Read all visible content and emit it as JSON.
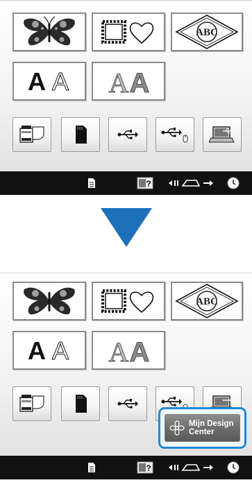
{
  "panels": {
    "top": {
      "categories": [
        {
          "name": "embroidery-patterns",
          "icon": "butterfly-icon"
        },
        {
          "name": "frame-patterns",
          "icon": "stamp-frame-and-heart-icon"
        },
        {
          "name": "monogram",
          "icon": "monogram-diamond-icon",
          "text": "ABC"
        },
        {
          "name": "character-patterns",
          "icon": "letters-icon",
          "text": [
            "A",
            "A"
          ]
        },
        {
          "name": "decorative-alphabet",
          "icon": "decorative-letters-icon",
          "text": [
            "A",
            "A"
          ]
        }
      ],
      "sources": [
        {
          "name": "machine-memory",
          "icon": "sewing-machine-pocket-icon"
        },
        {
          "name": "sd-card",
          "icon": "sd-card-icon"
        },
        {
          "name": "usb-port",
          "icon": "usb-icon"
        },
        {
          "name": "usb-mouse-port",
          "icon": "usb-mouse-icon"
        },
        {
          "name": "computer",
          "icon": "computer-usb-icon"
        }
      ]
    },
    "bottom": {
      "popup_button": {
        "label": "Mijn Design\nCenter",
        "icon": "flower-icon",
        "highlight_color": "#1d8ad6"
      }
    }
  },
  "statusbar": {
    "items": [
      "document-icon",
      "help-icon",
      "presser-foot-icon",
      "clock-icon"
    ]
  },
  "arrow": {
    "direction": "down",
    "color": "#1d6fba"
  }
}
